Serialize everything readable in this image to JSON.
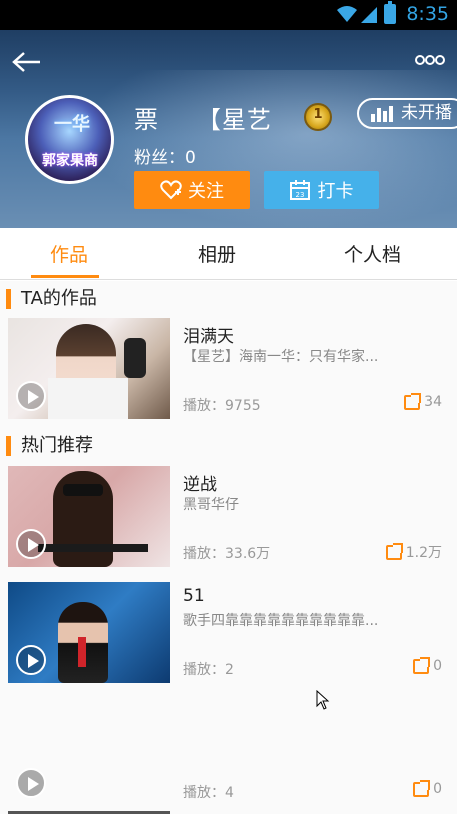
{
  "status_bar": {
    "time": "8:35"
  },
  "profile": {
    "name": "票　　【星艺",
    "avatar_text_top": "一华",
    "avatar_text_bottom": "郭家果商",
    "level": "1",
    "live_status": "未开播",
    "fans": "粉丝：0",
    "follow_label": "关注",
    "checkin_label": "打卡"
  },
  "tabs": [
    {
      "label": "作品",
      "active": true
    },
    {
      "label": "相册",
      "active": false
    },
    {
      "label": "个人档",
      "active": false
    }
  ],
  "sections": {
    "works_title": "TA的作品",
    "hot_title": "热门推荐"
  },
  "works": [
    {
      "title": "泪满天",
      "subtitle": "【星艺】海南一华：只有华家...",
      "plays": "播放：9755",
      "shares": "34"
    }
  ],
  "hot": [
    {
      "title": "逆战",
      "subtitle": "黑哥华仔",
      "plays": "播放：33.6万",
      "shares": "1.2万"
    },
    {
      "title": "51",
      "subtitle": "歌手四靠靠靠靠靠靠靠靠靠靠...",
      "plays": "播放：2",
      "shares": "0"
    },
    {
      "title": "",
      "subtitle": "",
      "plays": "播放：4",
      "shares": "0"
    }
  ],
  "colors": {
    "accent": "#ff8b10",
    "checkin": "#45b1ea"
  }
}
